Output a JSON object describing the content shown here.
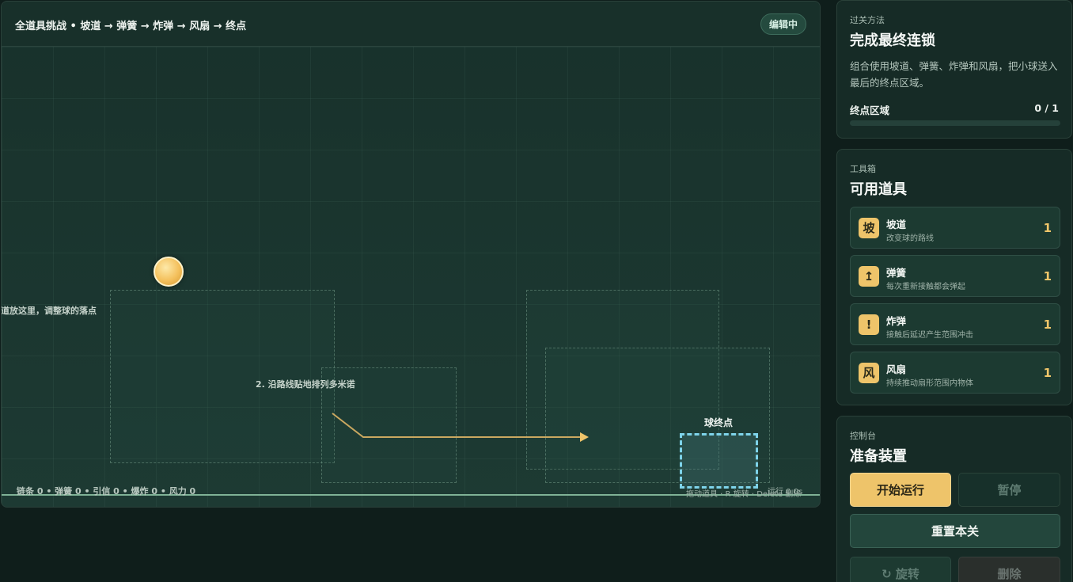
{
  "game": {
    "title": "全道具挑战 • 坡道 → 弹簧 → 炸弹 → 风扇 → 终点",
    "status_badge": "编辑中",
    "hint_1": "道放这里，调整球的落点",
    "hint_2": "2. 沿路线贴地排列多米诺",
    "goal_label": "球终点",
    "stats": "链条 0 • 弹簧 0 • 引信 0 • 爆炸 0 • 风力 0",
    "controls_hint": "拖动道具 · R 旋转 · Delete 删除",
    "run_time": "运行 0.0s"
  },
  "objective": {
    "kicker": "过关方法",
    "title": "完成最终连锁",
    "description": "组合使用坡道、弹簧、炸弹和风扇，把小球送入最后的终点区域。",
    "progress_label": "终点区域",
    "progress_count": "0 / 1",
    "progress_fraction": 0
  },
  "toolbox": {
    "kicker": "工具箱",
    "title": "可用道具",
    "tools": [
      {
        "icon": "坡",
        "name": "坡道",
        "desc": "改变球的路线",
        "count": "1"
      },
      {
        "icon": "↥",
        "name": "弹簧",
        "desc": "每次重新接触都会弹起",
        "count": "1"
      },
      {
        "icon": "!",
        "name": "炸弹",
        "desc": "接触后延迟产生范围冲击",
        "count": "1"
      },
      {
        "icon": "风",
        "name": "风扇",
        "desc": "持续推动扇形范围内物体",
        "count": "1"
      }
    ]
  },
  "console": {
    "kicker": "控制台",
    "title": "准备装置",
    "start_label": "开始运行",
    "pause_label": "暂停",
    "reset_label": "重置本关",
    "rotate_label": "↻ 旋转",
    "delete_label": "删除"
  },
  "colors": {
    "accent": "#eec46a",
    "goal": "#7ed3ea",
    "ground": "#7fb296"
  }
}
